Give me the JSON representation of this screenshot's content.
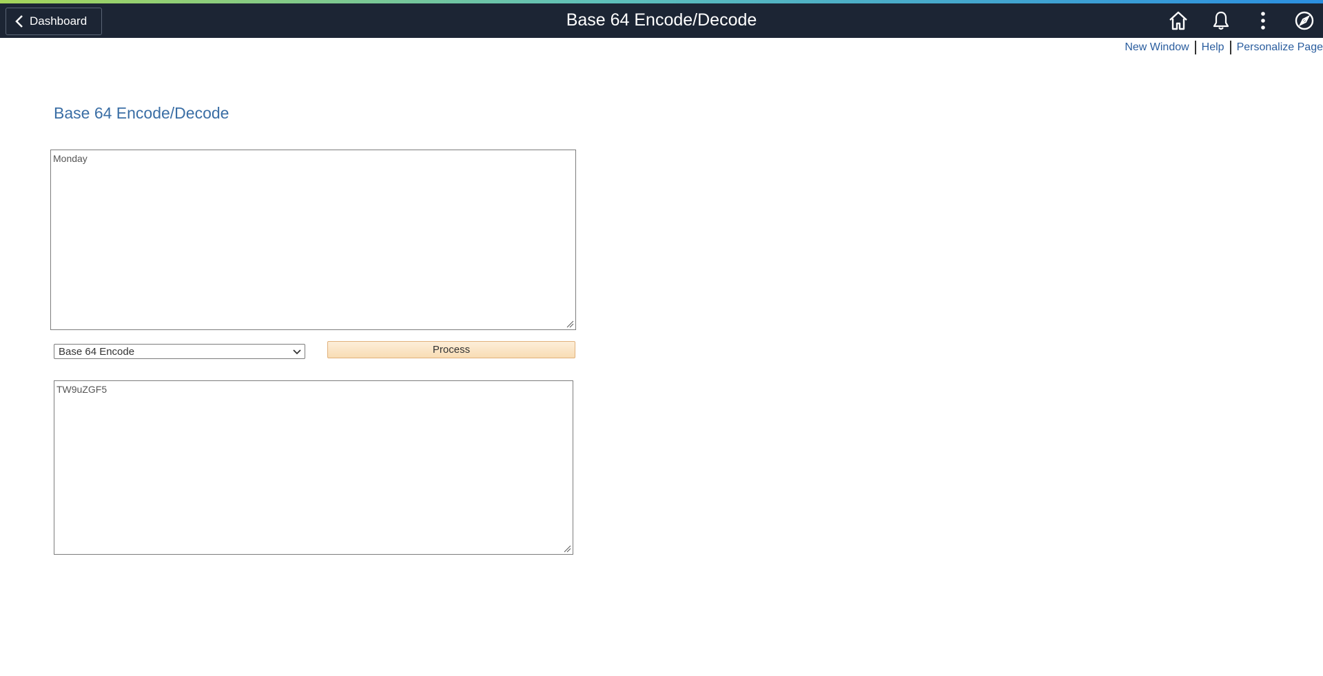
{
  "banner": {
    "back_label": "Dashboard",
    "title": "Base 64 Encode/Decode",
    "icons": [
      "home-icon",
      "bell-icon",
      "kebab-menu-icon",
      "navigator-compass-icon"
    ]
  },
  "utility_links": {
    "new_window": "New Window",
    "help": "Help",
    "personalize": "Personalize Page"
  },
  "page": {
    "title": "Base 64 Encode/Decode"
  },
  "form": {
    "input_text": "Monday",
    "mode_selected": "Base 64 Encode",
    "process_label": "Process",
    "output_text": "TW9uZGF5"
  },
  "colors": {
    "banner_bg": "#1c2534",
    "link": "#2a5d9e",
    "title": "#3a6ea5",
    "button_bg": "#f8dcb4"
  }
}
